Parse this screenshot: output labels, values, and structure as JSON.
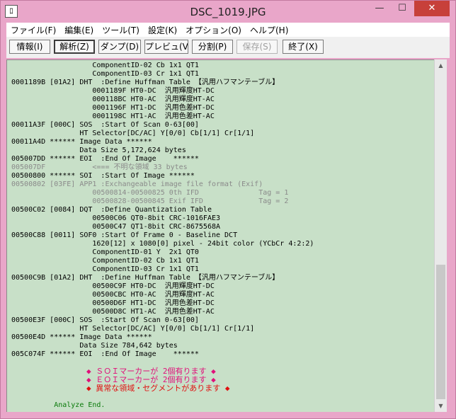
{
  "window": {
    "title": "DSC_1019.JPG",
    "app_icon": "ﾛ",
    "minimize": "—",
    "maximize": "☐",
    "close": "✕"
  },
  "menu": [
    "ファイル(F)",
    "編集(E)",
    "ツール(T)",
    "設定(K)",
    "オプション(O)",
    "ヘルプ(H)"
  ],
  "toolbar": {
    "info": "情報(I)",
    "analyze": "解析(Z)",
    "dump": "ダンプ(D)",
    "preview": "プレビュ(V)",
    "split": "分割(P)",
    "save": "保存(S)",
    "exit": "終了(X)"
  },
  "log_lines": [
    {
      "t": "                   ComponentID-02 Cb 1x1 QT1",
      "c": ""
    },
    {
      "t": "                   ComponentID-03 Cr 1x1 QT1",
      "c": ""
    },
    {
      "t": "0001189B [01A2] DHT  :Define Huffman Table 【汎用ハフマンテーブル】",
      "c": ""
    },
    {
      "t": "                   0001189F HT0-DC  汎用輝度HT-DC",
      "c": ""
    },
    {
      "t": "                   000118BC HT0-AC  汎用輝度HT-AC",
      "c": ""
    },
    {
      "t": "                   0001196F HT1-DC  汎用色差HT-DC",
      "c": ""
    },
    {
      "t": "                   0001198C HT1-AC  汎用色差HT-AC",
      "c": ""
    },
    {
      "t": "00011A3F [000C] SOS  :Start Of Scan 0-63[00]",
      "c": ""
    },
    {
      "t": "                HT Selector[DC/AC] Y[0/0] Cb[1/1] Cr[1/1]",
      "c": ""
    },
    {
      "t": "00011A4D ****** Image Data ******",
      "c": ""
    },
    {
      "t": "                Data Size 5,172,624 bytes",
      "c": ""
    },
    {
      "t": "005007DD ****** EOI  :End Of Image    ******",
      "c": ""
    },
    {
      "t": "005007DF           <=== 不明な領域 33 bytes",
      "c": "gray"
    },
    {
      "t": "00500800 ****** SOI  :Start Of Image ******",
      "c": ""
    },
    {
      "t": "00500802 [03FE] APP1 :Exchangeable image file format (Exif)",
      "c": "gray"
    },
    {
      "t": "                   00500814-00500825 0th IFD              Tag = 1",
      "c": "gray"
    },
    {
      "t": "                   00500828-00500845 Exif IFD             Tag = 2",
      "c": "gray"
    },
    {
      "t": "00500C02 [0084] DQT  :Define Quantization Table",
      "c": ""
    },
    {
      "t": "                   00500C06 QT0-8bit CRC-1016FAE3",
      "c": ""
    },
    {
      "t": "                   00500C47 QT1-8bit CRC-8675568A",
      "c": ""
    },
    {
      "t": "00500C88 [0011] SOF0 :Start Of Frame 0 - Baseline DCT",
      "c": ""
    },
    {
      "t": "                   1620[12] x 1080[0] pixel - 24bit color (YCbCr 4:2:2)",
      "c": ""
    },
    {
      "t": "                   ComponentID-01 Y  2x1 QT0",
      "c": ""
    },
    {
      "t": "                   ComponentID-02 Cb 1x1 QT1",
      "c": ""
    },
    {
      "t": "                   ComponentID-03 Cr 1x1 QT1",
      "c": ""
    },
    {
      "t": "00500C9B [01A2] DHT  :Define Huffman Table 【汎用ハフマンテーブル】",
      "c": ""
    },
    {
      "t": "                   00500C9F HT0-DC  汎用輝度HT-DC",
      "c": ""
    },
    {
      "t": "                   00500CBC HT0-AC  汎用輝度HT-AC",
      "c": ""
    },
    {
      "t": "                   00500D6F HT1-DC  汎用色差HT-DC",
      "c": ""
    },
    {
      "t": "                   00500D8C HT1-AC  汎用色差HT-AC",
      "c": ""
    },
    {
      "t": "00500E3F [000C] SOS  :Start Of Scan 0-63[00]",
      "c": ""
    },
    {
      "t": "                HT Selector[DC/AC] Y[0/0] Cb[1/1] Cr[1/1]",
      "c": ""
    },
    {
      "t": "00500E4D ****** Image Data ******",
      "c": ""
    },
    {
      "t": "                Data Size 784,642 bytes",
      "c": ""
    },
    {
      "t": "005C074F ****** EOI  :End Of Image    ******",
      "c": ""
    },
    {
      "t": "",
      "c": ""
    },
    {
      "t": "                ◆ ＳＯＩマーカーが 2個有ります ◆",
      "c": "mag"
    },
    {
      "t": "                ◆ ＥＯＩマーカーが 2個有ります ◆",
      "c": "mag"
    },
    {
      "t": "                ◆ 異常な領域・セグメントがあります ◆",
      "c": "red"
    },
    {
      "t": "",
      "c": ""
    },
    {
      "t": "          Analyze End.",
      "c": "green"
    }
  ],
  "scrollbar": {
    "up": "▲",
    "down": "▼"
  }
}
